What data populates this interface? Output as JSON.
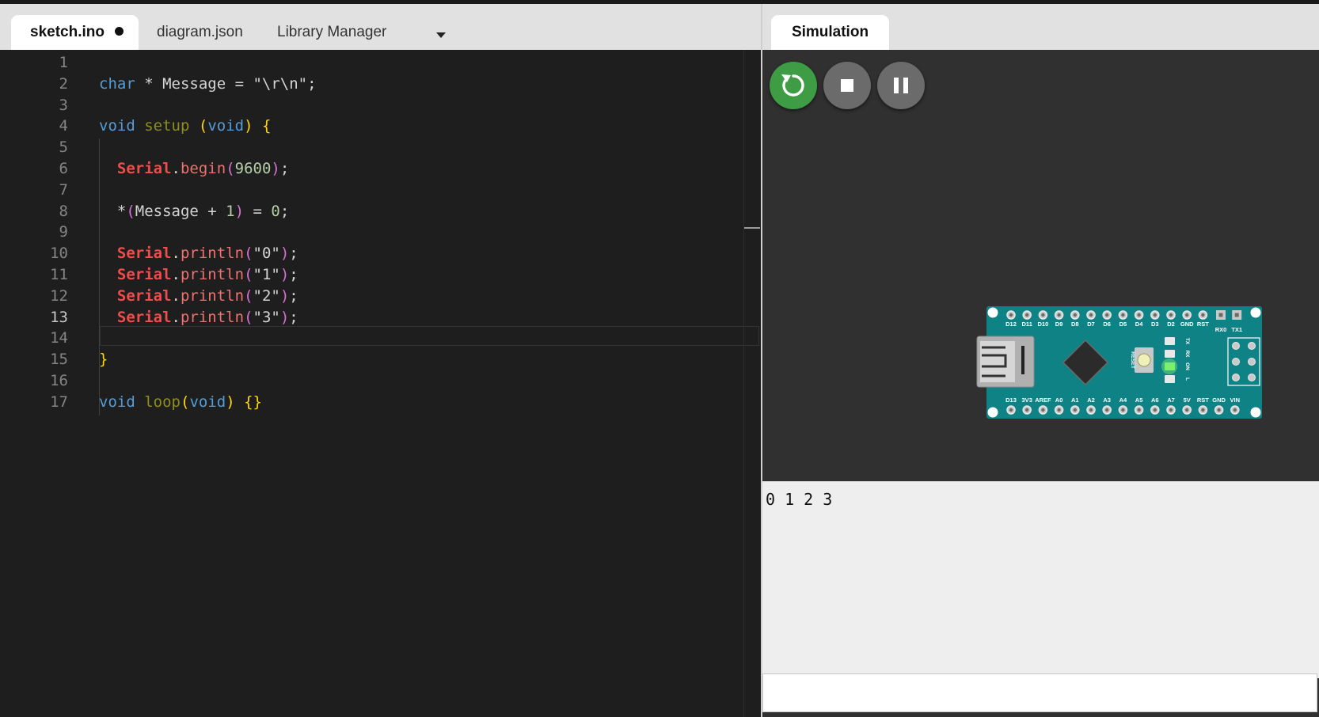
{
  "editor": {
    "tabs": [
      {
        "label": "sketch.ino"
      },
      {
        "label": "diagram.json"
      },
      {
        "label": "Library Manager"
      }
    ],
    "current_line": 13,
    "lines": [
      {
        "num": "1",
        "tokens": []
      },
      {
        "num": "2",
        "tokens": [
          [
            "kw",
            "char"
          ],
          [
            "",
            " * Message = "
          ],
          [
            "str",
            "\"\\r\\n\""
          ],
          [
            "",
            ";"
          ]
        ]
      },
      {
        "num": "3",
        "tokens": []
      },
      {
        "num": "4",
        "tokens": [
          [
            "kw",
            "void"
          ],
          [
            "",
            " "
          ],
          [
            "fn",
            "setup"
          ],
          [
            "",
            " "
          ],
          [
            "br1",
            "("
          ],
          [
            "kw",
            "void"
          ],
          [
            "br1",
            ")"
          ],
          [
            "",
            " "
          ],
          [
            "br1",
            "{"
          ]
        ]
      },
      {
        "num": "5",
        "tokens": []
      },
      {
        "num": "6",
        "tokens": [
          [
            "",
            "  "
          ],
          [
            "obj",
            "Serial"
          ],
          [
            "",
            "."
          ],
          [
            "mth",
            "begin"
          ],
          [
            "br2",
            "("
          ],
          [
            "num",
            "9600"
          ],
          [
            "br2",
            ")"
          ],
          [
            "",
            ";"
          ]
        ]
      },
      {
        "num": "7",
        "tokens": []
      },
      {
        "num": "8",
        "tokens": [
          [
            "",
            "  *"
          ],
          [
            "br2",
            "("
          ],
          [
            "",
            "Message + "
          ],
          [
            "num",
            "1"
          ],
          [
            "br2",
            ")"
          ],
          [
            "",
            " = "
          ],
          [
            "num",
            "0"
          ],
          [
            "",
            ";"
          ]
        ]
      },
      {
        "num": "9",
        "tokens": []
      },
      {
        "num": "10",
        "tokens": [
          [
            "",
            "  "
          ],
          [
            "obj",
            "Serial"
          ],
          [
            "",
            "."
          ],
          [
            "mth",
            "println"
          ],
          [
            "br2",
            "("
          ],
          [
            "str",
            "\"0\""
          ],
          [
            "br2",
            ")"
          ],
          [
            "",
            ";"
          ]
        ]
      },
      {
        "num": "11",
        "tokens": [
          [
            "",
            "  "
          ],
          [
            "obj",
            "Serial"
          ],
          [
            "",
            "."
          ],
          [
            "mth",
            "println"
          ],
          [
            "br2",
            "("
          ],
          [
            "str",
            "\"1\""
          ],
          [
            "br2",
            ")"
          ],
          [
            "",
            ";"
          ]
        ]
      },
      {
        "num": "12",
        "tokens": [
          [
            "",
            "  "
          ],
          [
            "obj",
            "Serial"
          ],
          [
            "",
            "."
          ],
          [
            "mth",
            "println"
          ],
          [
            "br2",
            "("
          ],
          [
            "str",
            "\"2\""
          ],
          [
            "br2",
            ")"
          ],
          [
            "",
            ";"
          ]
        ]
      },
      {
        "num": "13",
        "tokens": [
          [
            "",
            "  "
          ],
          [
            "obj",
            "Serial"
          ],
          [
            "",
            "."
          ],
          [
            "mth",
            "println"
          ],
          [
            "br2",
            "("
          ],
          [
            "str",
            "\"3\""
          ],
          [
            "br2",
            ")"
          ],
          [
            "",
            ";"
          ]
        ]
      },
      {
        "num": "14",
        "tokens": []
      },
      {
        "num": "15",
        "tokens": [
          [
            "br1",
            "}"
          ]
        ]
      },
      {
        "num": "16",
        "tokens": []
      },
      {
        "num": "17",
        "tokens": [
          [
            "kw",
            "void"
          ],
          [
            "",
            " "
          ],
          [
            "fn",
            "loop"
          ],
          [
            "br1",
            "("
          ],
          [
            "kw",
            "void"
          ],
          [
            "br1",
            ")"
          ],
          [
            "",
            " "
          ],
          [
            "br1",
            "{}"
          ]
        ]
      }
    ]
  },
  "simulation": {
    "tab_label": "Simulation",
    "controls": [
      {
        "name": "restart-button",
        "icon": "restart-icon",
        "color": "#3e9c44"
      },
      {
        "name": "stop-button",
        "icon": "stop-icon",
        "color": "#6b6b6b"
      },
      {
        "name": "pause-button",
        "icon": "pause-icon",
        "color": "#6b6b6b"
      }
    ],
    "board": {
      "top_pins": [
        "D12",
        "D11",
        "D10",
        "D9",
        "D8",
        "D7",
        "D6",
        "D5",
        "D4",
        "D3",
        "D2",
        "GND",
        "RST"
      ],
      "top_extra": [
        "RX0",
        "TX1"
      ],
      "bottom_pins": [
        "D13",
        "3V3",
        "AREF",
        "A0",
        "A1",
        "A2",
        "A3",
        "A4",
        "A5",
        "A6",
        "A7",
        "5V",
        "RST",
        "GND",
        "VIN"
      ],
      "leds": [
        "TX",
        "RX",
        "ON",
        "L"
      ],
      "reset_label": "RESET",
      "pcb_color": "#0f8286",
      "power_led_color": "#7cf06e"
    },
    "serial_monitor": {
      "output": "0 1 2 3",
      "input_value": ""
    }
  },
  "colors": {
    "keyword": "#569cd6",
    "function": "#8d8e1e",
    "bracket_1": "#ffd700",
    "bracket_2": "#da70d6",
    "object": "#f14c4c",
    "method": "#f07170",
    "number": "#b5cea8"
  }
}
